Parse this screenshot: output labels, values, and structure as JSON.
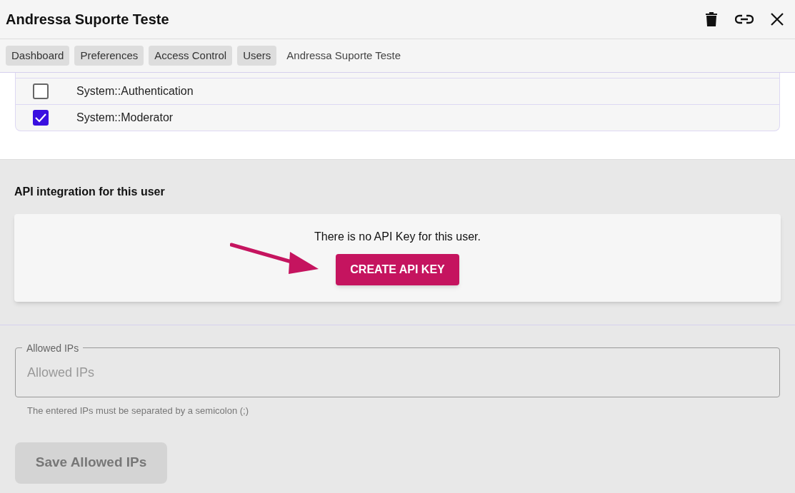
{
  "window": {
    "title": "Andressa Suporte Teste"
  },
  "breadcrumbs": [
    {
      "label": "Dashboard",
      "kind": "link"
    },
    {
      "label": "Preferences",
      "kind": "link"
    },
    {
      "label": "Access Control",
      "kind": "link"
    },
    {
      "label": "Users",
      "kind": "link"
    },
    {
      "label": "Andressa Suporte Teste",
      "kind": "current"
    }
  ],
  "roles": [
    {
      "label": "System::Authentication",
      "checked": false
    },
    {
      "label": "System::Moderator",
      "checked": true
    }
  ],
  "api": {
    "heading": "API integration for this user",
    "message": "There is no API Key for this user.",
    "button": "CREATE API KEY"
  },
  "allowed_ips": {
    "label": "Allowed IPs",
    "placeholder": "Allowed IPs",
    "helper": "The entered IPs must be separated by a semicolon (;)",
    "button": {
      "label": "Save Allowed IPs",
      "disabled": true
    }
  }
}
